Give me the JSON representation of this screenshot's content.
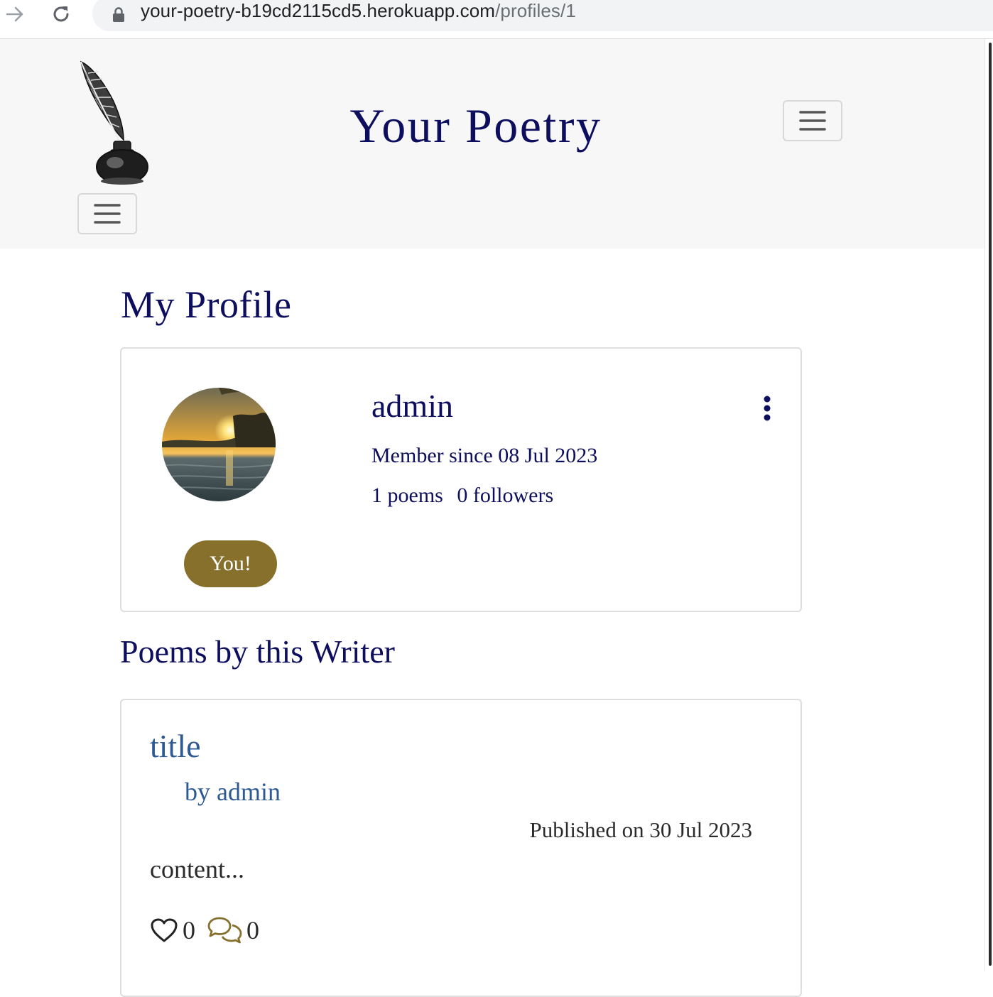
{
  "browser": {
    "url_host": "your-poetry-b19cd2115cd5.herokuapp.com",
    "url_path": "/profiles/1"
  },
  "header": {
    "site_title": "Your Poetry",
    "logo_icon": "quill-inkwell-logo",
    "menu_icon": "hamburger-icon"
  },
  "profile": {
    "heading": "My Profile",
    "name": "admin",
    "member_since": "Member since 08 Jul 2023",
    "poems_count": "1 poems",
    "followers_count": "0 followers",
    "badge": "You!",
    "badge_color": "#876f2c",
    "menu_icon": "kebab-menu-icon"
  },
  "poems_section": {
    "heading": "Poems by this Writer",
    "poems": [
      {
        "title": "title",
        "author": "by admin",
        "published": "Published on 30 Jul 2023",
        "excerpt": "content...",
        "likes": "0",
        "comments": "0"
      }
    ]
  },
  "colors": {
    "primary": "#0d0f5e",
    "link": "#2e5a93",
    "accent": "#876f2c",
    "header_bg": "#f7f7f8"
  }
}
